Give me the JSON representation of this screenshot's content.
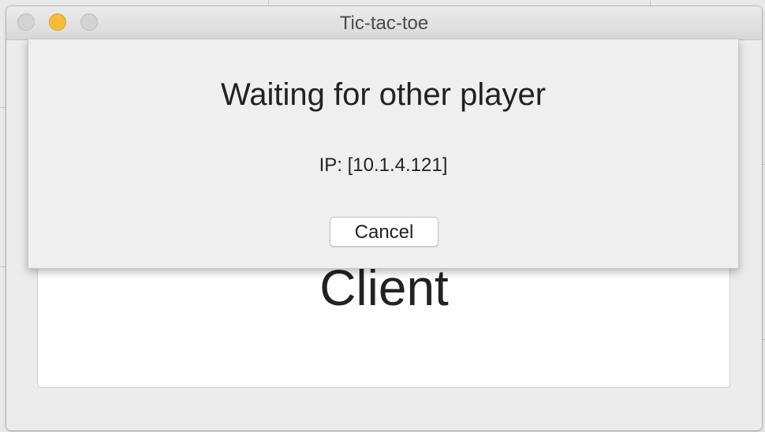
{
  "window": {
    "title": "Tic-tac-toe"
  },
  "dialog": {
    "title": "Waiting for other player",
    "ip_text": "IP: [10.1.4.121]",
    "cancel_label": "Cancel"
  },
  "main": {
    "client_label": "Client"
  },
  "colors": {
    "minimize": "#f6bb3a",
    "inactive_light": "#d3d3d3",
    "window_bg": "#ececec",
    "card_bg": "#ffffff"
  },
  "icons": {
    "close": "close-icon",
    "minimize": "minimize-icon",
    "zoom": "zoom-icon"
  }
}
